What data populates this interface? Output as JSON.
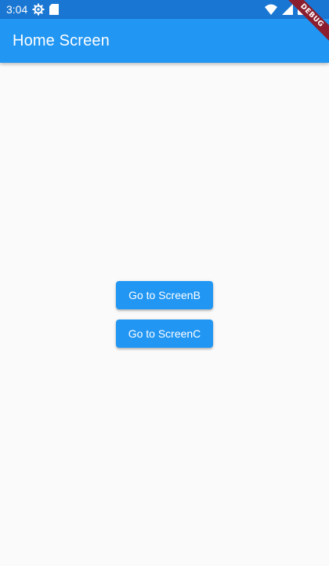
{
  "status_bar": {
    "time": "3:04",
    "icons": [
      "settings-gear-icon",
      "sd-card-icon",
      "wifi-icon",
      "cellular-signal-icon",
      "battery-icon"
    ],
    "color": "#1976d2"
  },
  "app_bar": {
    "title": "Home Screen",
    "color": "#2196f3"
  },
  "debug_banner": {
    "label": "DEBUG"
  },
  "main": {
    "buttons": [
      {
        "label": "Go to ScreenB"
      },
      {
        "label": "Go to ScreenC"
      }
    ],
    "background": "#fafafa"
  }
}
